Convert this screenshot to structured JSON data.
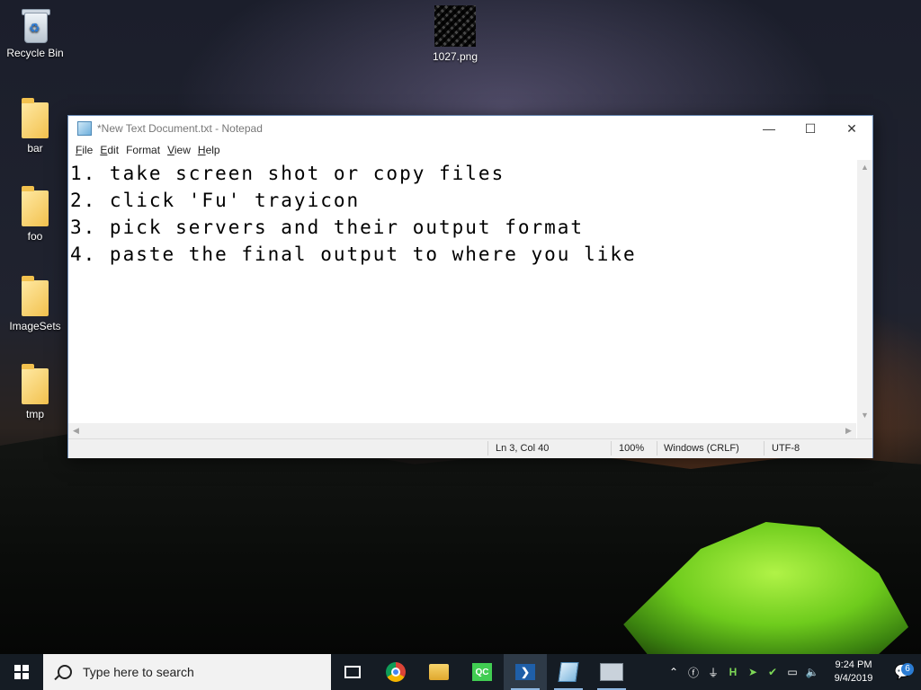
{
  "desktop": {
    "icons": [
      {
        "label": "Recycle Bin",
        "icon": "recycle-bin-icon"
      },
      {
        "label": "1027.png",
        "icon": "image-file-icon"
      },
      {
        "label": "bar",
        "icon": "folder-icon"
      },
      {
        "label": "foo",
        "icon": "folder-icon"
      },
      {
        "label": "ImageSets",
        "icon": "folder-icon"
      },
      {
        "label": "tmp",
        "icon": "folder-icon"
      }
    ]
  },
  "notepad": {
    "title": "*New Text Document.txt - Notepad",
    "menu": [
      {
        "label": "File",
        "mnemonic": "F",
        "rest": "ile"
      },
      {
        "label": "Edit",
        "mnemonic": "E",
        "rest": "dit"
      },
      {
        "label": "Format",
        "mnemonic": "",
        "rest": "Format"
      },
      {
        "label": "View",
        "mnemonic": "V",
        "rest": "iew"
      },
      {
        "label": "Help",
        "mnemonic": "H",
        "rest": "elp"
      }
    ],
    "lines": [
      "1. take screen shot or copy files",
      "2. click 'Fu' trayicon",
      "3. pick servers and their output format",
      "4. paste the final output to where you like"
    ],
    "status": {
      "position": "Ln 3, Col 40",
      "zoom": "100%",
      "line_ending": "Windows (CRLF)",
      "encoding": "UTF-8"
    },
    "window_buttons": {
      "minimize": "—",
      "maximize": "☐",
      "close": "✕"
    }
  },
  "taskbar": {
    "search_placeholder": "Type here to search",
    "apps": [
      {
        "name": "task-view-icon"
      },
      {
        "name": "chrome-icon"
      },
      {
        "name": "file-explorer-icon"
      },
      {
        "name": "qt-creator-icon",
        "text": "QC"
      },
      {
        "name": "powershell-icon",
        "text": "❯"
      },
      {
        "name": "notepad-icon"
      },
      {
        "name": "printer-icon"
      }
    ],
    "tray": {
      "icons": [
        "chevron-up-icon",
        "fu-tray-icon",
        "usb-icon",
        "h-icon",
        "arrow-icon",
        "check-icon",
        "network-icon",
        "volume-icon"
      ],
      "time": "9:24 PM",
      "date": "9/4/2019",
      "notification_count": "6"
    }
  }
}
